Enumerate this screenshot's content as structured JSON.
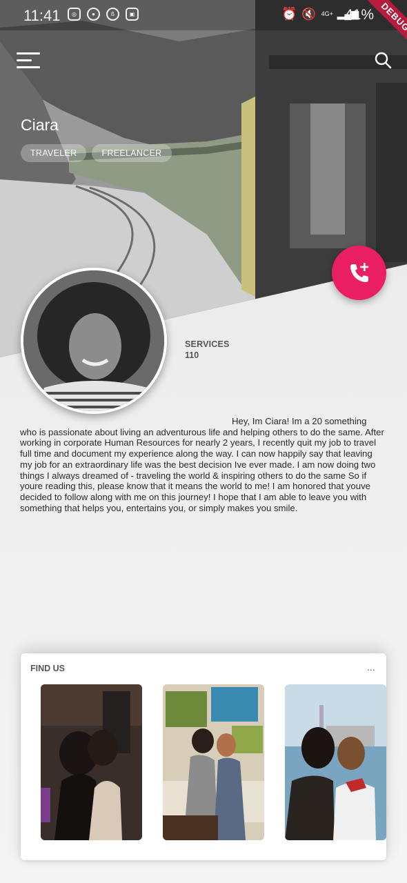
{
  "status_bar": {
    "time": "11:41",
    "battery": "41%",
    "network": "4G+",
    "debug_label": "DEBUG",
    "left_icons": [
      "instagram-icon",
      "line-icon",
      "circle-icon",
      "gallery-icon"
    ],
    "right_icons": [
      "alarm-icon",
      "mute-icon",
      "network-icon",
      "signal-icon"
    ]
  },
  "profile": {
    "name": "Ciara",
    "tags": [
      "TRAVELER",
      "FREELANCER"
    ],
    "services_label": "SERVICES",
    "services_value": "110",
    "bio": "Hey, Im Ciara! Im a 20 something who is passionate about living an adventurous life and helping others to do the same. After working in corporate Human Resources for nearly 2 years, I recently quit my job to travel full time and document my experience along the way. I can now happily say that leaving my job for an extraordinary life was the best decision Ive ever made. I am now doing two things I always dreamed of - traveling the world & inspiring others to do the same So if youre reading this, please know that it means the world to me! I am honored that youve decided to follow along with me on this journey! I hope that I am able to leave you with something that helps you, entertains you, or simply makes you smile."
  },
  "find_us": {
    "title": "FIND US",
    "more": "...",
    "photos": [
      "photo-1",
      "photo-2",
      "photo-3"
    ]
  },
  "colors": {
    "accent": "#e91e63",
    "debug": "#b71c3c"
  }
}
